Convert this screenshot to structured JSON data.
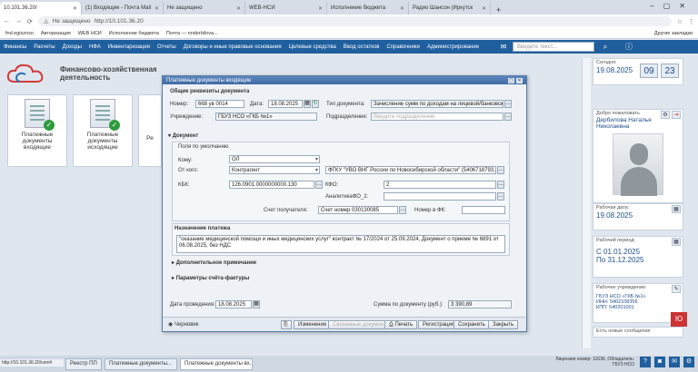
{
  "browser": {
    "tabs": [
      {
        "label": "10.101.36.20/",
        "active": true
      },
      {
        "label": "(1) Входящие - Почта Mail"
      },
      {
        "label": "Не защищено"
      },
      {
        "label": "WEB-НСИ"
      },
      {
        "label": "Исполнение бюджета"
      },
      {
        "label": "Радио Шансон (Иркутск"
      }
    ],
    "new_tab": "+",
    "url_warning": "Не защищено",
    "url": "http://10.101.36.20",
    "bookmarks": [
      "fnd.egisznso",
      "Авторизация",
      "WEB НСИ",
      "Исполнение бюджета",
      "Почта — nnderbilova..."
    ],
    "bookmarks_other": "Другие закладки",
    "status_url": "http://10.101.36.20/cem#"
  },
  "menu": {
    "items": [
      "Финансы",
      "Расчеты",
      "Доходы",
      "НФА",
      "Инвентаризация",
      "Отчеты",
      "Договоры и иные правовые основания",
      "Целевые средства",
      "Ввод остатков",
      "Справочники",
      "Администрирование"
    ],
    "search_placeholder": "Введите текст..."
  },
  "logo": {
    "line1": "Финансово-хозяйственная деятельность"
  },
  "tiles": [
    {
      "label": "Платежные документы входящие"
    },
    {
      "label": "Платежные документы исходящие"
    },
    {
      "label": "Ре"
    }
  ],
  "modal": {
    "title": "Платежные документы входящие",
    "common": {
      "section": "Общие реквизиты документа",
      "number_label": "Номер:",
      "number_value": "668 ув 0014",
      "date_label": "Дата:",
      "date_value": "18.08.2025",
      "doctype_label": "Тип документа:",
      "doctype_value": "Зачисление сумм по доходам на лицевой/банковский",
      "inst_label": "Учреждение:",
      "inst_value": "ГБУЗ НСО «ГКБ №1»",
      "subdiv_label": "Подразделение:",
      "subdiv_placeholder": "Введите подразделение"
    },
    "document": {
      "section": "Документ",
      "default_fields": "Поля по умолчанию",
      "to_label": "Кому:",
      "to_value": "ОЛ",
      "from_label": "От кого:",
      "from_value": "Контрагент",
      "from_org": "ФГКУ \"УВО ВНГ России по Новосибирской области\" (5406718793, 5",
      "kbk_label": "КБК:",
      "kbk_value": "126.0901.0000000000.130",
      "kfo_label": "КФО:",
      "kfo_value": "2",
      "analytics_label": "АналитикаФО_2:",
      "recipient_label": "Счет получателя:",
      "recipient_value": "Счет номер 030130085",
      "fk_label": "Номер в ФК:"
    },
    "purpose": {
      "section": "Назначение платежа",
      "text": "\"оказание медицинской помощи и иных медицинских услуг\" контракт № 17/2024 от 25.09.2024, Документ о приеме № 6891 от 06.08.2025, без НДС"
    },
    "extra_note": "Дополнительное примечание",
    "invoice_params": "Параметры счёта-фактуры",
    "date_conducted_label": "Дата проведения:",
    "date_conducted_value": "18.08.2025",
    "sum_label": "Сумма по документу (руб.):",
    "sum_value": "3 390,89",
    "footer": {
      "draft": "Черновик",
      "changes": "Изменения",
      "related": "Связанные документы",
      "print": "Печать",
      "register": "Регистрация",
      "save": "Сохранить",
      "close": "Закрыть"
    }
  },
  "right_panel": {
    "today_label": "Сегодня:",
    "today_value": "19.08.2025",
    "hour": "09",
    "minute": "23",
    "welcome_label": "Добро пожаловать",
    "user_name": "Дербилова Наталья Николаевна",
    "work_date_label": "Рабочая дата:",
    "work_date_value": "19.08.2025",
    "work_period_label": "Рабочий период:",
    "period_from_label": "С",
    "period_from": "01.01.2025",
    "period_to_label": "По",
    "period_to": "31.12.2025",
    "work_inst_label": "Рабочее учреждение:",
    "inst_name": "ГБУЗ НСО «ГКБ №1»",
    "inn": "ИНН: 5402108356",
    "kpp": "КПП: 540201001",
    "messages": "Есть новые сообщения"
  },
  "taskbar": {
    "items": [
      "Реестр ПП",
      "Платежные документы...",
      "Платежные документы вх..."
    ],
    "license_line1": "Лицензия номер: 11636, Обладатель:",
    "license_line2": "ГБУЗ НСО"
  },
  "badge": "Ю"
}
